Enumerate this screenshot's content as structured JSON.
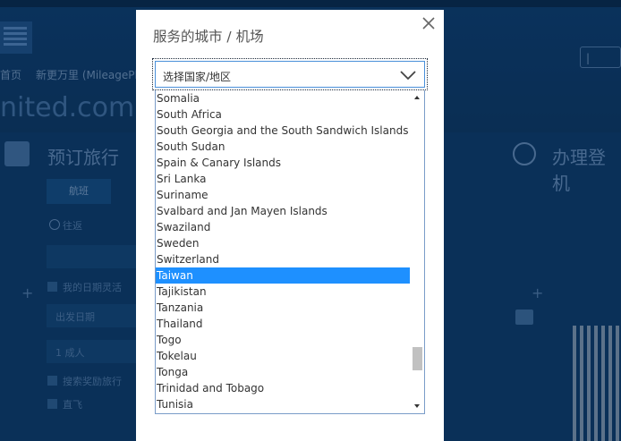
{
  "background": {
    "brand_text": "nited.com",
    "nav_items": [
      "首页",
      "新更万里 (MileagePlus)"
    ],
    "help_label": "|",
    "section_title_left": "预订旅行",
    "section_title_right": "办理登机",
    "tab_label": "航班",
    "radio_label": "往返",
    "check_label_1": "我的日期灵活",
    "field_label_1": "出发日期",
    "field_label_2": "1 成人",
    "check_label_2": "搜索奖励旅行",
    "check_label_3": "直飞"
  },
  "modal": {
    "title": "服务的城市 / 机场",
    "select": {
      "value": "选择国家/地区"
    },
    "options": [
      "Somalia",
      "South Africa",
      "South Georgia and the South Sandwich Islands",
      "South Sudan",
      "Spain & Canary Islands",
      "Sri Lanka",
      "Suriname",
      "Svalbard and Jan Mayen Islands",
      "Swaziland",
      "Sweden",
      "Switzerland",
      "Taiwan",
      "Tajikistan",
      "Tanzania",
      "Thailand",
      "Togo",
      "Tokelau",
      "Tonga",
      "Trinidad and Tobago",
      "Tunisia"
    ],
    "selected_option": "Taiwan"
  },
  "colors": {
    "selection": "#1e90ff",
    "background_page": "#0c3a68",
    "select_border": "#4a90d9"
  },
  "icons": {
    "close": "close-icon",
    "chevron": "chevron-down-icon",
    "scroll_up": "arrow-up-icon",
    "scroll_down": "arrow-down-icon"
  }
}
